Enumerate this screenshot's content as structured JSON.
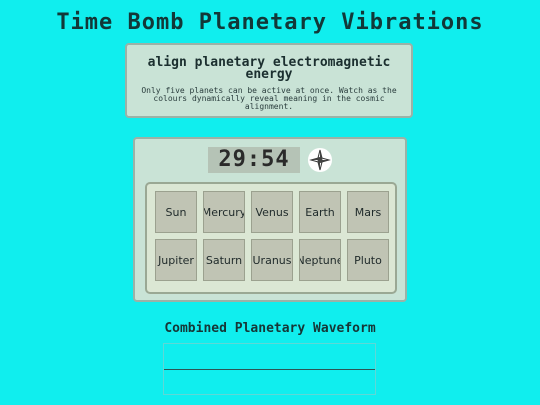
{
  "app": {
    "title": "Time Bomb Planetary Vibrations"
  },
  "info": {
    "heading": "align planetary electromagnetic energy",
    "body": "Only five planets can be active at once. Watch as the colours dynamically reveal meaning in the cosmic alignment."
  },
  "control": {
    "timer": "29:54",
    "compass_icon": "compass-star-icon"
  },
  "planets": [
    {
      "label": "Sun"
    },
    {
      "label": "Mercury"
    },
    {
      "label": "Venus"
    },
    {
      "label": "Earth"
    },
    {
      "label": "Mars"
    },
    {
      "label": "Jupiter"
    },
    {
      "label": "Saturn"
    },
    {
      "label": "Uranus"
    },
    {
      "label": "Neptune"
    },
    {
      "label": "Pluto"
    }
  ],
  "waveform": {
    "title": "Combined Planetary Waveform"
  },
  "colors": {
    "background": "#10eeee",
    "card": "#c9e3d6",
    "button": "#c0c4b4"
  }
}
